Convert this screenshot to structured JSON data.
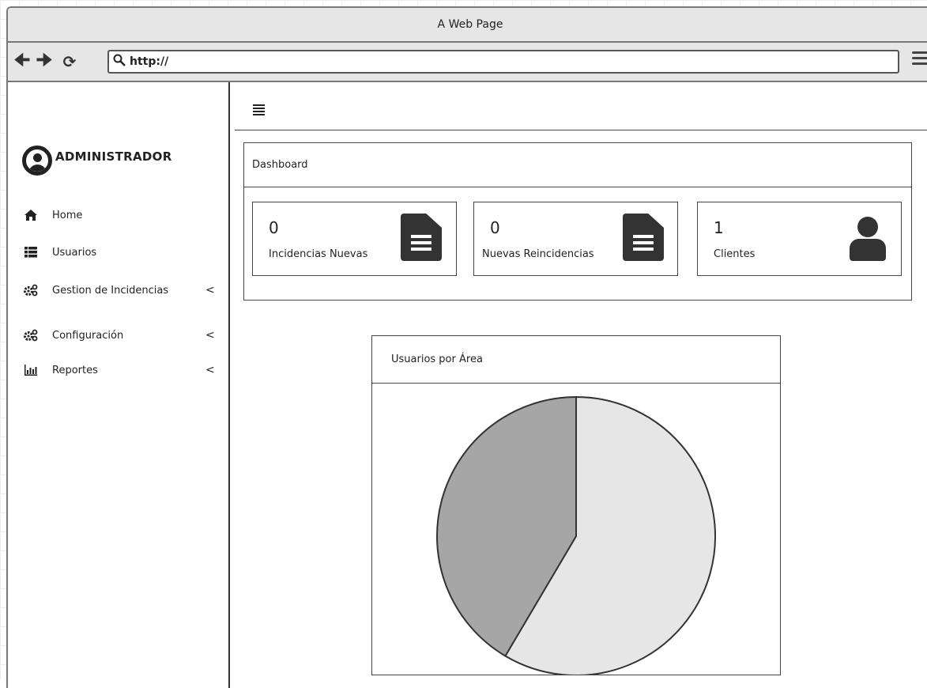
{
  "window": {
    "title": "A Web Page"
  },
  "browser": {
    "back_icon": "arrow-left-icon",
    "forward_icon": "arrow-right-icon",
    "reload_icon": "reload-icon",
    "url": "http://",
    "menu_icon": "hamburger-icon"
  },
  "sidebar": {
    "user_name": "ADMINISTRADOR",
    "items": [
      {
        "label": "Home",
        "icon": "home-icon",
        "caret": ""
      },
      {
        "label": "Usuarios",
        "icon": "list-icon",
        "caret": ""
      },
      {
        "label": "Gestion de Incidencias",
        "icon": "gears-icon",
        "caret": "<"
      },
      {
        "label": "Configuración",
        "icon": "gears-icon",
        "caret": "<"
      },
      {
        "label": "Reportes",
        "icon": "bar-chart-icon",
        "caret": "<"
      }
    ]
  },
  "dashboard": {
    "title": "Dashboard",
    "cards": [
      {
        "count": "0",
        "label": "Incidencias Nuevas",
        "icon": "document-icon"
      },
      {
        "count": "0",
        "label": "Nuevas Reincidencias",
        "icon": "document-icon"
      },
      {
        "count": "1",
        "label": "Clientes",
        "icon": "user-icon"
      }
    ]
  },
  "chart_panel": {
    "title": "Usuarios por Área"
  },
  "chart_data": {
    "type": "pie",
    "title": "Usuarios por Área",
    "slices": [
      {
        "value": 58.5,
        "color": "#e6e6e6"
      },
      {
        "value": 41.5,
        "color": "#a6a6a6"
      }
    ]
  },
  "colors": {
    "sidebar_border": "#333333",
    "chrome_bg": "#e6e6e6",
    "icon_dark": "#333333"
  }
}
